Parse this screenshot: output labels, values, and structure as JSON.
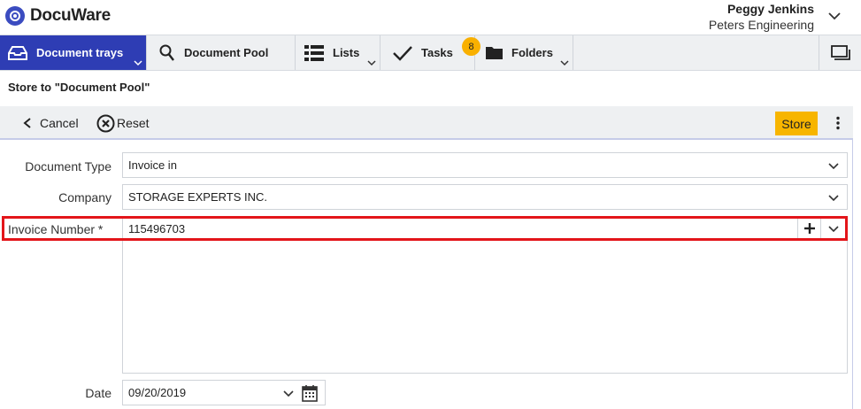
{
  "app": {
    "name": "DocuWare"
  },
  "user": {
    "name": "Peggy Jenkins",
    "organization": "Peters Engineering"
  },
  "nav": {
    "items": [
      {
        "label": "Document trays"
      },
      {
        "label": "Document Pool"
      },
      {
        "label": "Lists"
      },
      {
        "label": "Tasks",
        "badge": "8"
      },
      {
        "label": "Folders"
      }
    ]
  },
  "page": {
    "title": "Store to \"Document Pool\""
  },
  "toolbar": {
    "cancel_label": "Cancel",
    "reset_label": "Reset",
    "store_label": "Store"
  },
  "form": {
    "document_type": {
      "label": "Document Type",
      "value": "Invoice in"
    },
    "company": {
      "label": "Company",
      "value": "STORAGE EXPERTS INC."
    },
    "invoice_number": {
      "label": "Invoice Number *",
      "value": "115496703"
    },
    "date": {
      "label": "Date",
      "value": "09/20/2019"
    }
  },
  "colors": {
    "accent": "#2e3db4",
    "store": "#f7b500",
    "highlight": "#e3151a",
    "badge": "#f9b000"
  }
}
